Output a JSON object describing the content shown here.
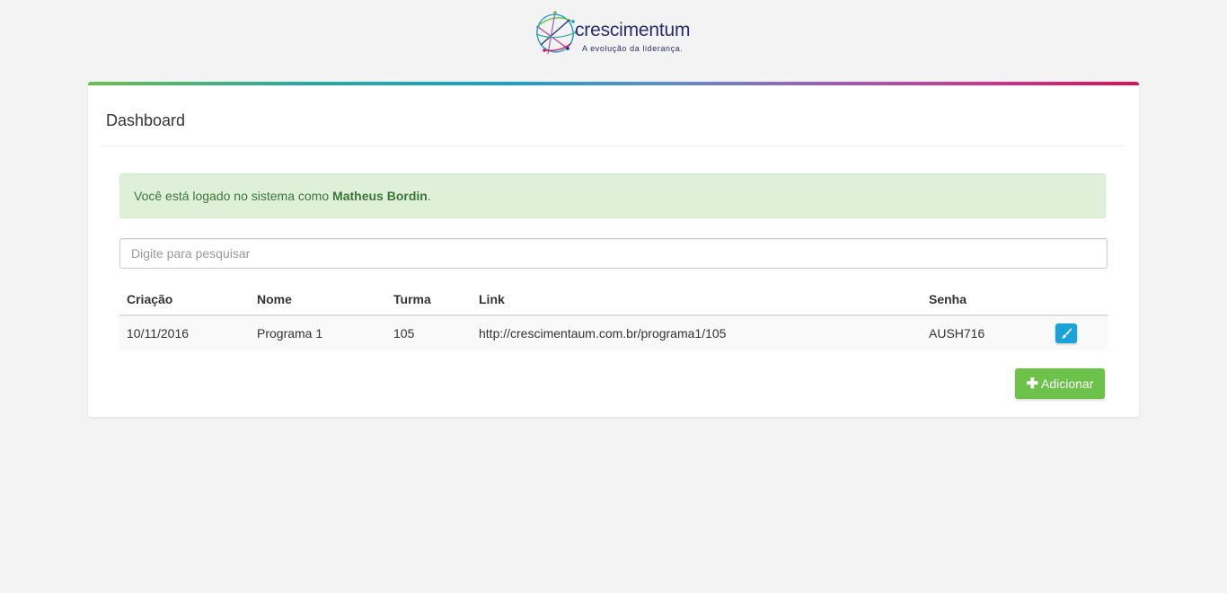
{
  "brand": {
    "name": "crescimentum",
    "tagline": "A evolução da liderança."
  },
  "card": {
    "title": "Dashboard"
  },
  "alert": {
    "prefix": "Você está logado no sistema como ",
    "user": "Matheus Bordin",
    "suffix": "."
  },
  "search": {
    "placeholder": "Digite para pesquisar",
    "value": ""
  },
  "table": {
    "headers": [
      "Criação",
      "Nome",
      "Turma",
      "Link",
      "Senha",
      ""
    ],
    "rows": [
      {
        "criacao": "10/11/2016",
        "nome": "Programa 1",
        "turma": "105",
        "link": "http://crescimentaum.com.br/programa1/105",
        "senha": "AUSH716",
        "action_icon": "brush-icon"
      }
    ]
  },
  "actions": {
    "add_label": "Adicionar",
    "add_icon": "plus-icon"
  },
  "colors": {
    "accent_green": "#6cc24a",
    "edit_blue": "#1aa3d8",
    "alert_bg": "#dff0d8",
    "alert_text": "#3c763d",
    "brand_navy": "#2b2c6b"
  }
}
